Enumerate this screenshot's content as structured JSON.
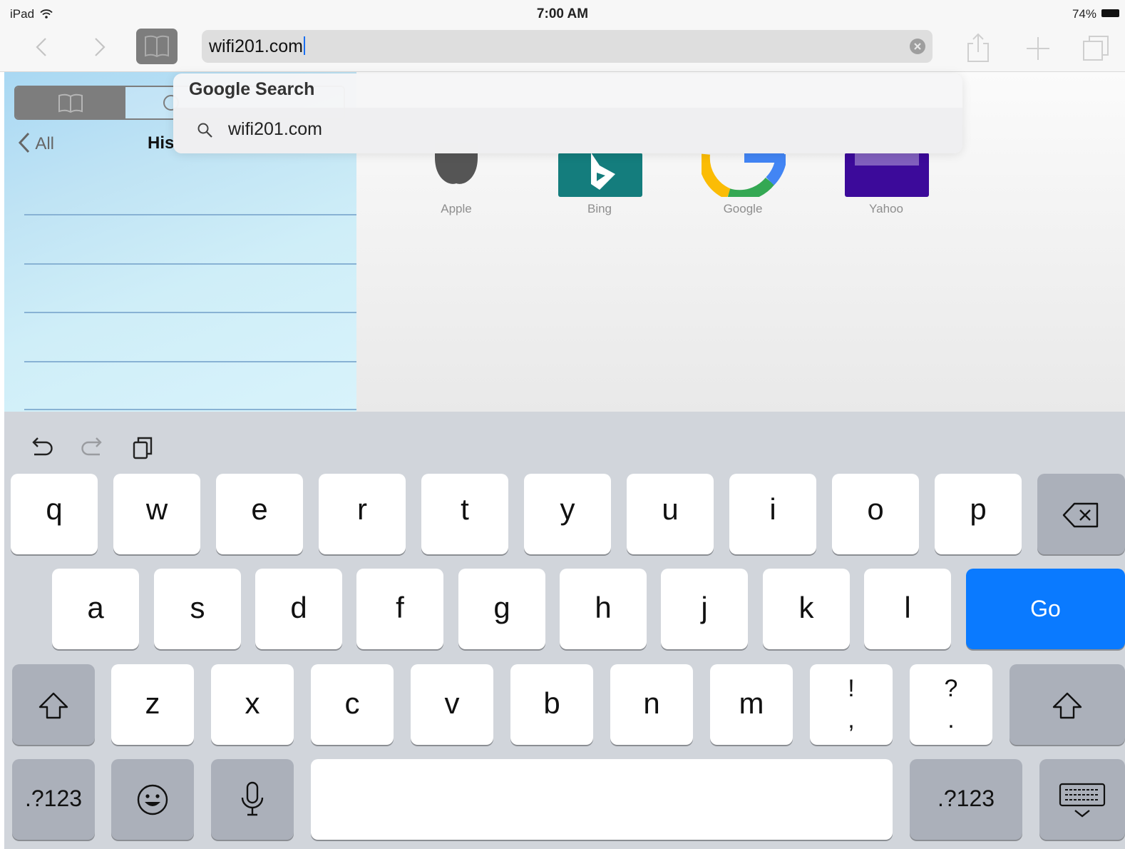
{
  "status_bar": {
    "device": "iPad",
    "time": "7:00 AM",
    "battery": "74%"
  },
  "toolbar": {
    "url_value": "wifi201.com",
    "icons": [
      "back-icon",
      "forward-icon",
      "bookmarks-icon",
      "clear-icon",
      "share-icon",
      "new-tab-icon",
      "tabs-icon"
    ]
  },
  "sidebar": {
    "back_label": "All",
    "title": "His",
    "segments": [
      "bookmarks-icon",
      "reading-list-icon"
    ]
  },
  "favorites": [
    {
      "label": "Apple",
      "color": "#555555"
    },
    {
      "label": "Bing",
      "color": "#147d7d"
    },
    {
      "label": "Google",
      "color": "#4285f4"
    },
    {
      "label": "Yahoo",
      "color": "#3c0a9a"
    }
  ],
  "suggestions": {
    "header": "Google Search",
    "items": [
      {
        "text": "wifi201.com",
        "icon": "search-icon"
      }
    ]
  },
  "keyboard": {
    "shortcuts": [
      "undo-icon",
      "redo-icon",
      "paste-icon"
    ],
    "row1": [
      "q",
      "w",
      "e",
      "r",
      "t",
      "y",
      "u",
      "i",
      "o",
      "p"
    ],
    "row2": [
      "a",
      "s",
      "d",
      "f",
      "g",
      "h",
      "j",
      "k",
      "l"
    ],
    "row3": [
      "z",
      "x",
      "c",
      "v",
      "b",
      "n",
      "m"
    ],
    "punct1": {
      "top": "!",
      "bottom": ","
    },
    "punct2": {
      "top": "?",
      "bottom": "."
    },
    "go_label": "Go",
    "numbers_label": ".?123",
    "accent_color": "#0a7aff"
  }
}
